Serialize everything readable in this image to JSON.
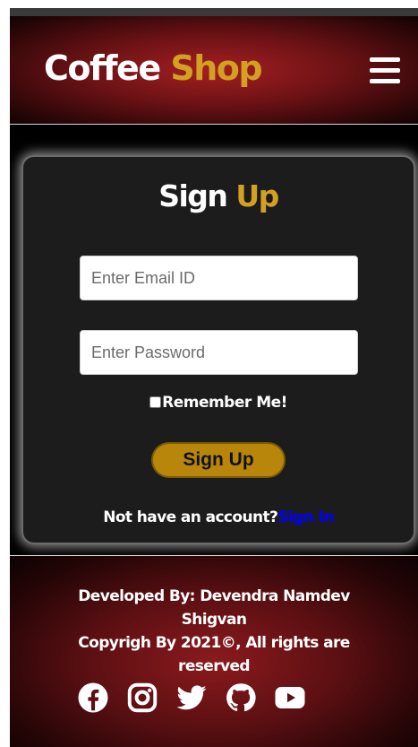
{
  "header": {
    "brand_main": "Coffee",
    "brand_accent": "Shop",
    "menu_icon": "hamburger-menu-icon"
  },
  "signup": {
    "title_main": "Sign",
    "title_accent": "Up",
    "email_placeholder": "Enter Email ID",
    "password_placeholder": "Enter Password",
    "remember_label": "Remember Me!",
    "remember_checked": false,
    "submit_label": "Sign Up",
    "switch_prompt": "Not have an account?",
    "switch_link": "Sign In"
  },
  "footer": {
    "developer": "Developed By: Devendra Namdev Shigvan",
    "copyright": "Copyrigh By 2021©, All rights are reserved",
    "social_icons": [
      "facebook-icon",
      "instagram-icon",
      "twitter-icon",
      "github-icon",
      "youtube-icon"
    ]
  },
  "colors": {
    "accent": "#d3a021",
    "button": "#b8860b",
    "link": "#0000ff",
    "header_red": "#a51f22",
    "card_bg": "#1c1c1c"
  }
}
